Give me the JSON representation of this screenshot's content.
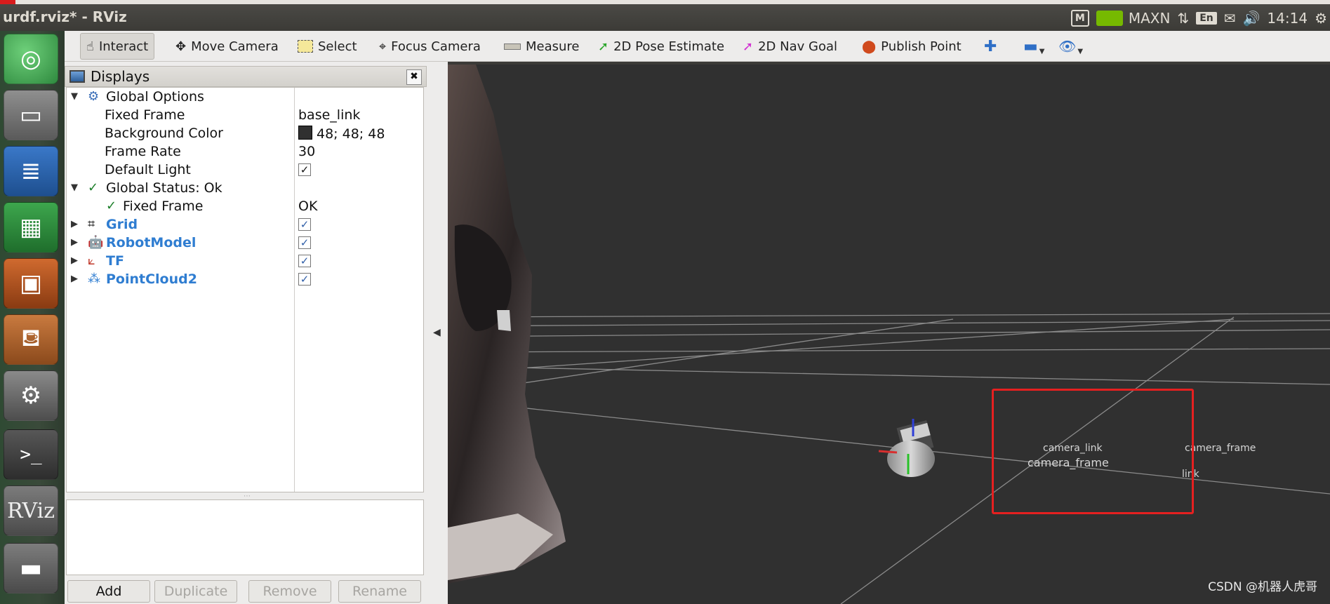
{
  "window": {
    "title": "urdf.rviz* - RViz"
  },
  "tray": {
    "gpu_mode": "MAXN",
    "keyboard": "En",
    "time": "14:14"
  },
  "launcher": {
    "rviz_label": "RViz"
  },
  "toolbar": {
    "tools": [
      {
        "label": "Interact",
        "icon": "hand-pointer-icon"
      },
      {
        "label": "Move Camera",
        "icon": "move-camera-icon"
      },
      {
        "label": "Select",
        "icon": "select-icon"
      },
      {
        "label": "Focus Camera",
        "icon": "focus-camera-icon"
      },
      {
        "label": "Measure",
        "icon": "ruler-icon"
      },
      {
        "label": "2D Pose Estimate",
        "icon": "pose-arrow-icon"
      },
      {
        "label": "2D Nav Goal",
        "icon": "nav-goal-arrow-icon"
      },
      {
        "label": "Publish Point",
        "icon": "map-pin-icon"
      }
    ]
  },
  "displays": {
    "title": "Displays",
    "global_options": {
      "label": "Global Options",
      "fixed_frame_label": "Fixed Frame",
      "fixed_frame_value": "base_link",
      "background_color_label": "Background Color",
      "background_color_value": "48; 48; 48",
      "background_color_hex": "#303030",
      "frame_rate_label": "Frame Rate",
      "frame_rate_value": "30",
      "default_light_label": "Default Light",
      "default_light_checked": true
    },
    "global_status": {
      "label": "Global Status: Ok",
      "fixed_frame_label": "Fixed Frame",
      "fixed_frame_value": "OK"
    },
    "items": [
      {
        "label": "Grid",
        "checked": true,
        "icon": "grid-icon"
      },
      {
        "label": "RobotModel",
        "checked": true,
        "icon": "robot-model-icon"
      },
      {
        "label": "TF",
        "checked": true,
        "icon": "tf-axes-icon"
      },
      {
        "label": "PointCloud2",
        "checked": true,
        "icon": "point-cloud-icon"
      }
    ],
    "buttons": {
      "add": "Add",
      "duplicate": "Duplicate",
      "remove": "Remove",
      "rename": "Rename"
    }
  },
  "view": {
    "tf_labels": [
      "camera_link",
      "camera_frame",
      "camera_frame",
      "link"
    ],
    "accent_color": "#e52020"
  },
  "watermark": "CSDN @机器人虎哥"
}
